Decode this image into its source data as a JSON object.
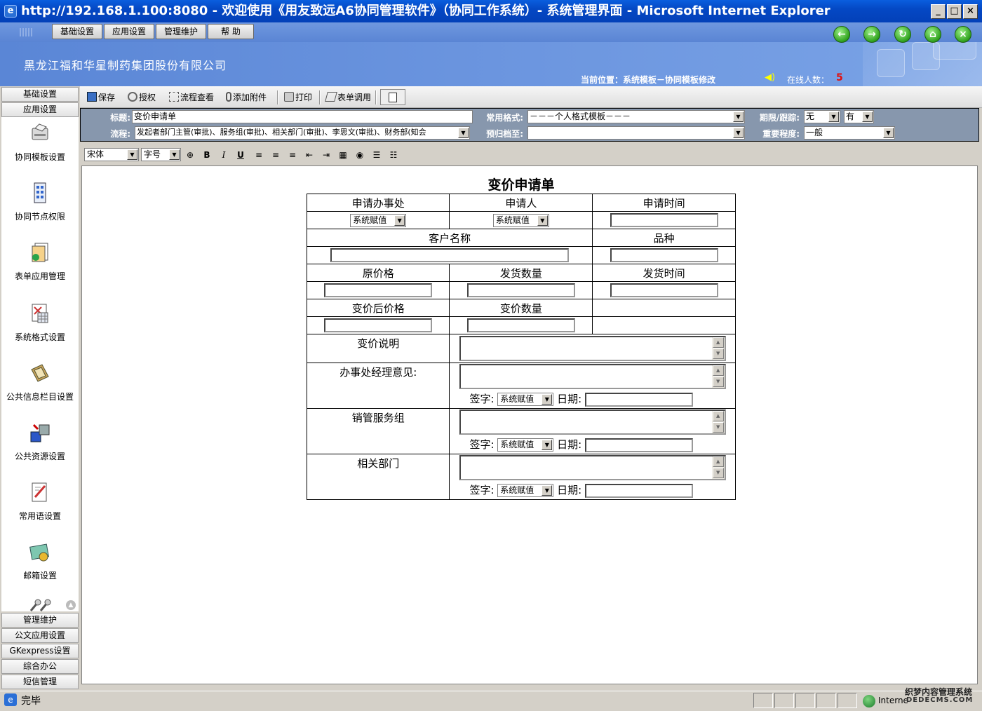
{
  "window": {
    "title": "http://192.168.1.100:8080 - 欢迎使用《用友致远A6协同管理软件》（协同工作系统）- 系统管理界面 - Microsoft Internet Explorer"
  },
  "menu": [
    "基础设置",
    "应用设置",
    "管理维护",
    "帮 助"
  ],
  "header": {
    "company": "黑龙江福和华星制药集团股份有限公司",
    "location": "当前位置：系统模板－协同模板修改",
    "online_label": "在线人数：",
    "online_count": "5"
  },
  "sidebar": {
    "top_tabs": [
      "基础设置",
      "应用设置"
    ],
    "items": [
      "协同模板设置",
      "协同节点权限",
      "表单应用管理",
      "系统格式设置",
      "公共信息栏目设置",
      "公共资源设置",
      "常用语设置",
      "邮箱设置"
    ],
    "bottom_tabs": [
      "管理维护",
      "公文应用设置",
      "GKexpress设置",
      "综合办公",
      "短信管理"
    ]
  },
  "toolbar": [
    "保存",
    "授权",
    "流程查看",
    "添加附件",
    "打印",
    "表单调用"
  ],
  "meta": {
    "title_label": "标题:",
    "title_value": "变价申请单",
    "flow_label": "流程:",
    "flow_value": "发起者部门主管(审批)、服务组(审批)、相关部门(审批)、李思文(审批)、财务部(知会",
    "format_label": "常用格式:",
    "format_value": "－－－个人格式模板－－－",
    "archive_label": "预归档至:",
    "archive_value": "",
    "deadline_label": "期限/跟踪:",
    "deadline_value": "无",
    "track_value": "有",
    "importance_label": "重要程度:",
    "importance_value": "一般"
  },
  "editor": {
    "font": "宋体",
    "size": "字号"
  },
  "form": {
    "title": "变价申请单",
    "office": "申请办事处",
    "applicant": "申请人",
    "apply_time": "申请时间",
    "sys_value": "系统赋值",
    "customer": "客户名称",
    "variety": "品种",
    "orig_price": "原价格",
    "ship_qty": "发货数量",
    "ship_time": "发货时间",
    "new_price": "变价后价格",
    "change_qty": "变价数量",
    "note": "变价说明",
    "manager_opinion": "办事处经理意见:",
    "sales_group": "销管服务组",
    "related_dept": "相关部门",
    "sign": "签字:",
    "date": "日期:"
  },
  "status": {
    "text": "完毕",
    "zone": "Interne",
    "watermark": "织梦内容管理系统",
    "watermark2": "DEDECMS.COM"
  }
}
